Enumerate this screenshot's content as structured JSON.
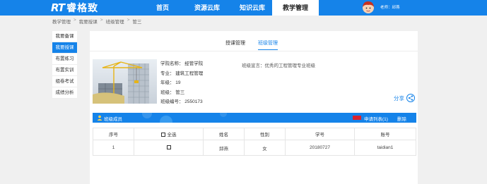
{
  "header": {
    "logo_rt": "RT",
    "logo_name": "睿格致",
    "nav": [
      {
        "label": "首页"
      },
      {
        "label": "资源云库"
      },
      {
        "label": "知识云库"
      },
      {
        "label": "教学管理"
      }
    ],
    "user_text": "老师：邱燕"
  },
  "breadcrumb": [
    "教学管理",
    "我要授课",
    "班级管理",
    "管三"
  ],
  "sidebar": {
    "items": [
      {
        "label": "我要备课"
      },
      {
        "label": "我要授课"
      },
      {
        "label": "布置练习"
      },
      {
        "label": "布置实训"
      },
      {
        "label": "组卷考试"
      },
      {
        "label": "成绩分析"
      }
    ]
  },
  "tabs": [
    {
      "label": "授课管理"
    },
    {
      "label": "班级管理"
    }
  ],
  "class_info": {
    "college": "学院名称： 经管学院",
    "major": "专业： 建筑工程管理",
    "grade": "年级： 19",
    "class": "班级： 管三",
    "class_no": "班级编号： 2550173",
    "declaration": "班级宣言：优秀的工程管理专业班级"
  },
  "share_label": "分享",
  "member_bar": {
    "label": "班级成员",
    "apply_list": "申请列表(1)",
    "delete": "删除"
  },
  "table": {
    "headers": [
      "序号",
      "全选",
      "姓名",
      "性别",
      "学号",
      "账号"
    ],
    "rows": [
      {
        "index": "1",
        "name": "邱燕",
        "gender": "女",
        "student_no": "20180727",
        "account": "taidian1"
      }
    ]
  },
  "colors": {
    "primary": "#1583e9",
    "page_bg": "#f0f0f0",
    "flag_red": "#d9232e"
  }
}
